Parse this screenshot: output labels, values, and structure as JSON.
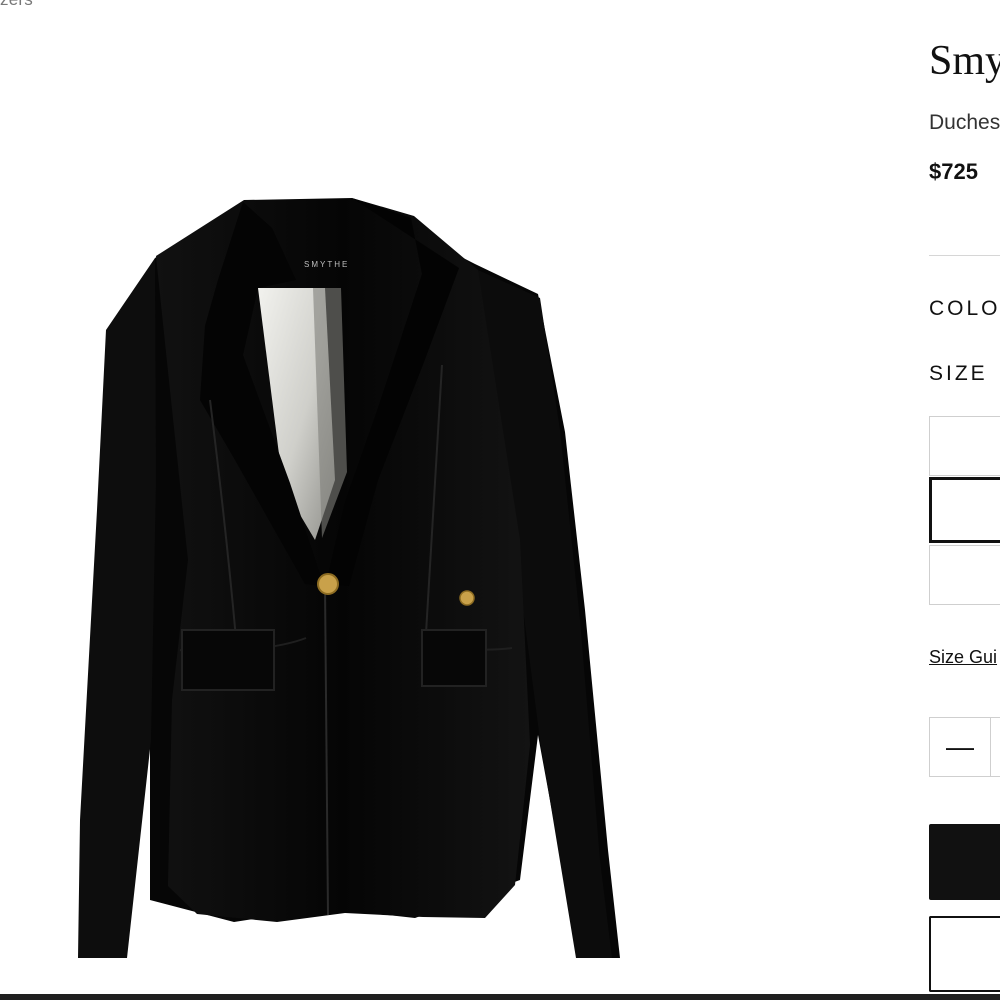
{
  "breadcrumb": {
    "label": "zers"
  },
  "product": {
    "brand": "Smy",
    "name": "Duches",
    "price": "$725",
    "image_label": "SMYTHE"
  },
  "options": {
    "color_label": "COLO",
    "size_label": "SIZE",
    "size_guide_label": "Size Gui"
  },
  "quantity": {
    "decrement_symbol": "—"
  },
  "colors": {
    "primary": "#111111",
    "border": "#cfcfcf",
    "lining": "#d9d9d4",
    "button_gold": "#c9a14a"
  }
}
